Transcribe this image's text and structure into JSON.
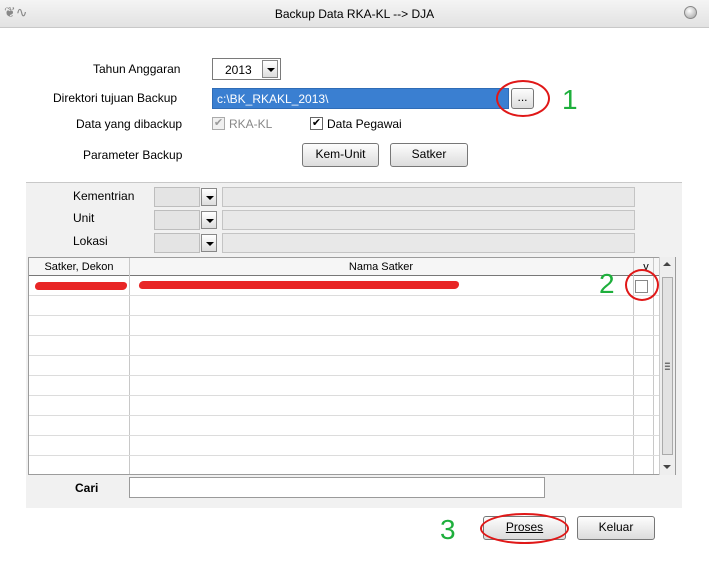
{
  "window": {
    "title": "Backup Data RKA-KL --> DJA"
  },
  "form": {
    "year_label": "Tahun Anggaran",
    "year_value": "2013",
    "dir_label": "Direktori tujuan Backup",
    "dir_value": "c:\\BK_RKAKL_2013\\",
    "browse_label": "...",
    "data_label": "Data yang dibackup",
    "opt_rkakl": "RKA-KL",
    "opt_pegawai": "Data Pegawai",
    "param_label": "Parameter Backup",
    "kemunit_label": "Kem-Unit",
    "satker_label": "Satker"
  },
  "filters": {
    "kementrian": "Kementrian",
    "unit": "Unit",
    "lokasi": "Lokasi"
  },
  "table": {
    "col_satker": "Satker, Dekon",
    "col_nama": "Nama Satker",
    "col_check": "v"
  },
  "search": {
    "label": "Cari"
  },
  "actions": {
    "proses": "Proses",
    "keluar": "Keluar"
  },
  "annotations": {
    "one": "1",
    "two": "2",
    "three": "3"
  },
  "colors": {
    "selection": "#3a7fd1",
    "annotation_ring": "#e01818",
    "annotation_digit": "#1eaf3c",
    "redaction": "#e61414"
  }
}
